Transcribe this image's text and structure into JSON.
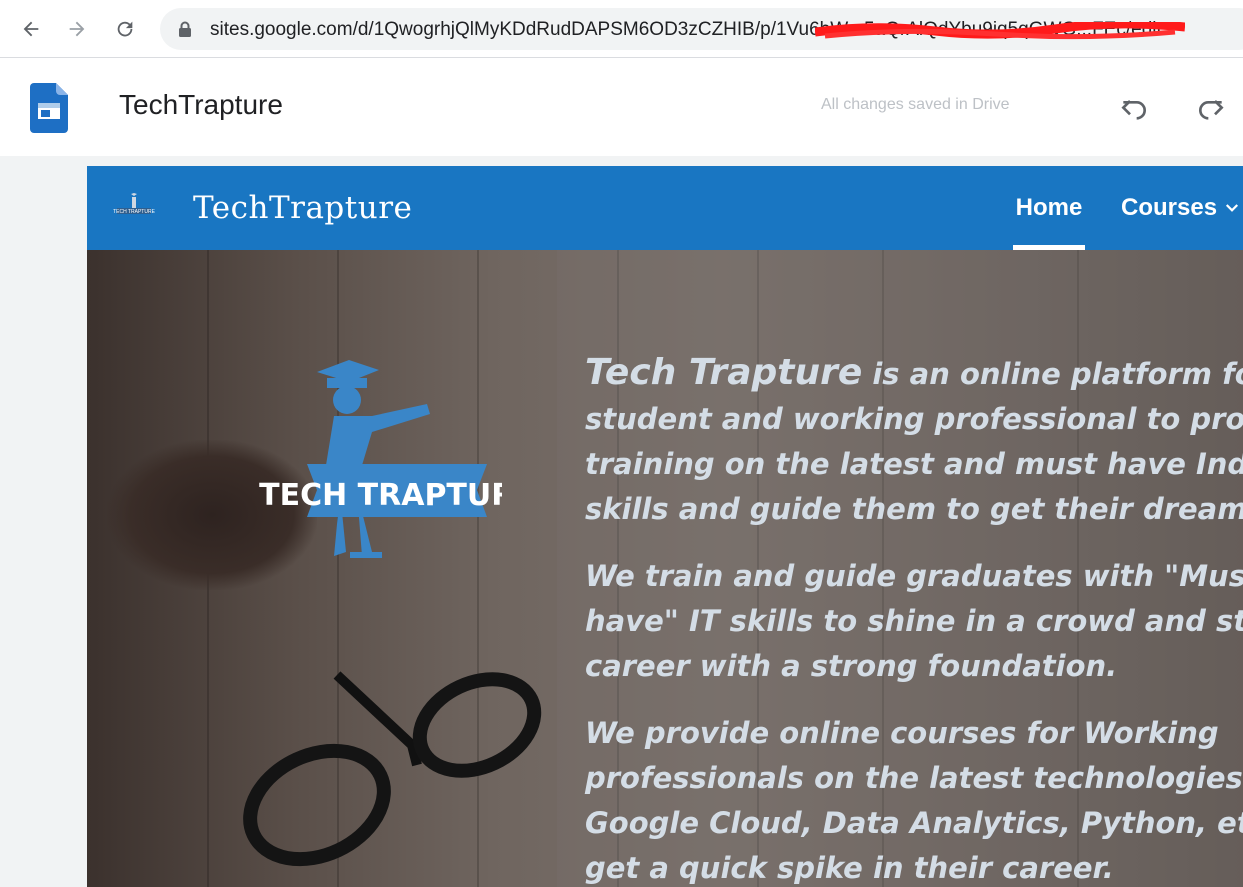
{
  "browser": {
    "url": "sites.google.com/d/1QwogrhjQlMyKDdRudDAPSM6OD3zCZHIB/p/1Vu6bWcr5aQrAlQdYbu9iq5qGWG...FEc/edit"
  },
  "editor": {
    "title": "TechTrapture",
    "save_status": "All changes saved in Drive"
  },
  "site": {
    "title": "TechTrapture",
    "nav": {
      "home": "Home",
      "courses": "Courses"
    },
    "logo_text": "TECH TRAPTURE",
    "hero": {
      "brand": "Tech Trapture",
      "p1_line1_rest": " is an online platform fo",
      "p1_line2": "student and working professional to provi",
      "p1_line3": "training on the latest and must have Indu",
      "p1_line4": "skills and guide them to get their dream jo",
      "p2_line1": " We train and guide graduates with \"Must",
      "p2_line2": "have\" IT skills to shine in a  crowd and sta",
      "p2_line3": "career with a strong foundation.",
      "p3_line1": " We provide online courses for Working",
      "p3_line2": "professionals on the latest technologies li",
      "p3_line3": "Google Cloud, Data Analytics, Python, etc.",
      "p3_line4": "get a quick spike in their career."
    }
  },
  "colors": {
    "nav_blue": "#1976c2",
    "logo_blue": "#3a86c8",
    "hero_text": "#d4dde6"
  },
  "icons": [
    "back-arrow-icon",
    "forward-arrow-icon",
    "reload-icon",
    "lock-icon",
    "google-sites-icon",
    "undo-icon",
    "redo-icon",
    "chevron-down-icon"
  ]
}
